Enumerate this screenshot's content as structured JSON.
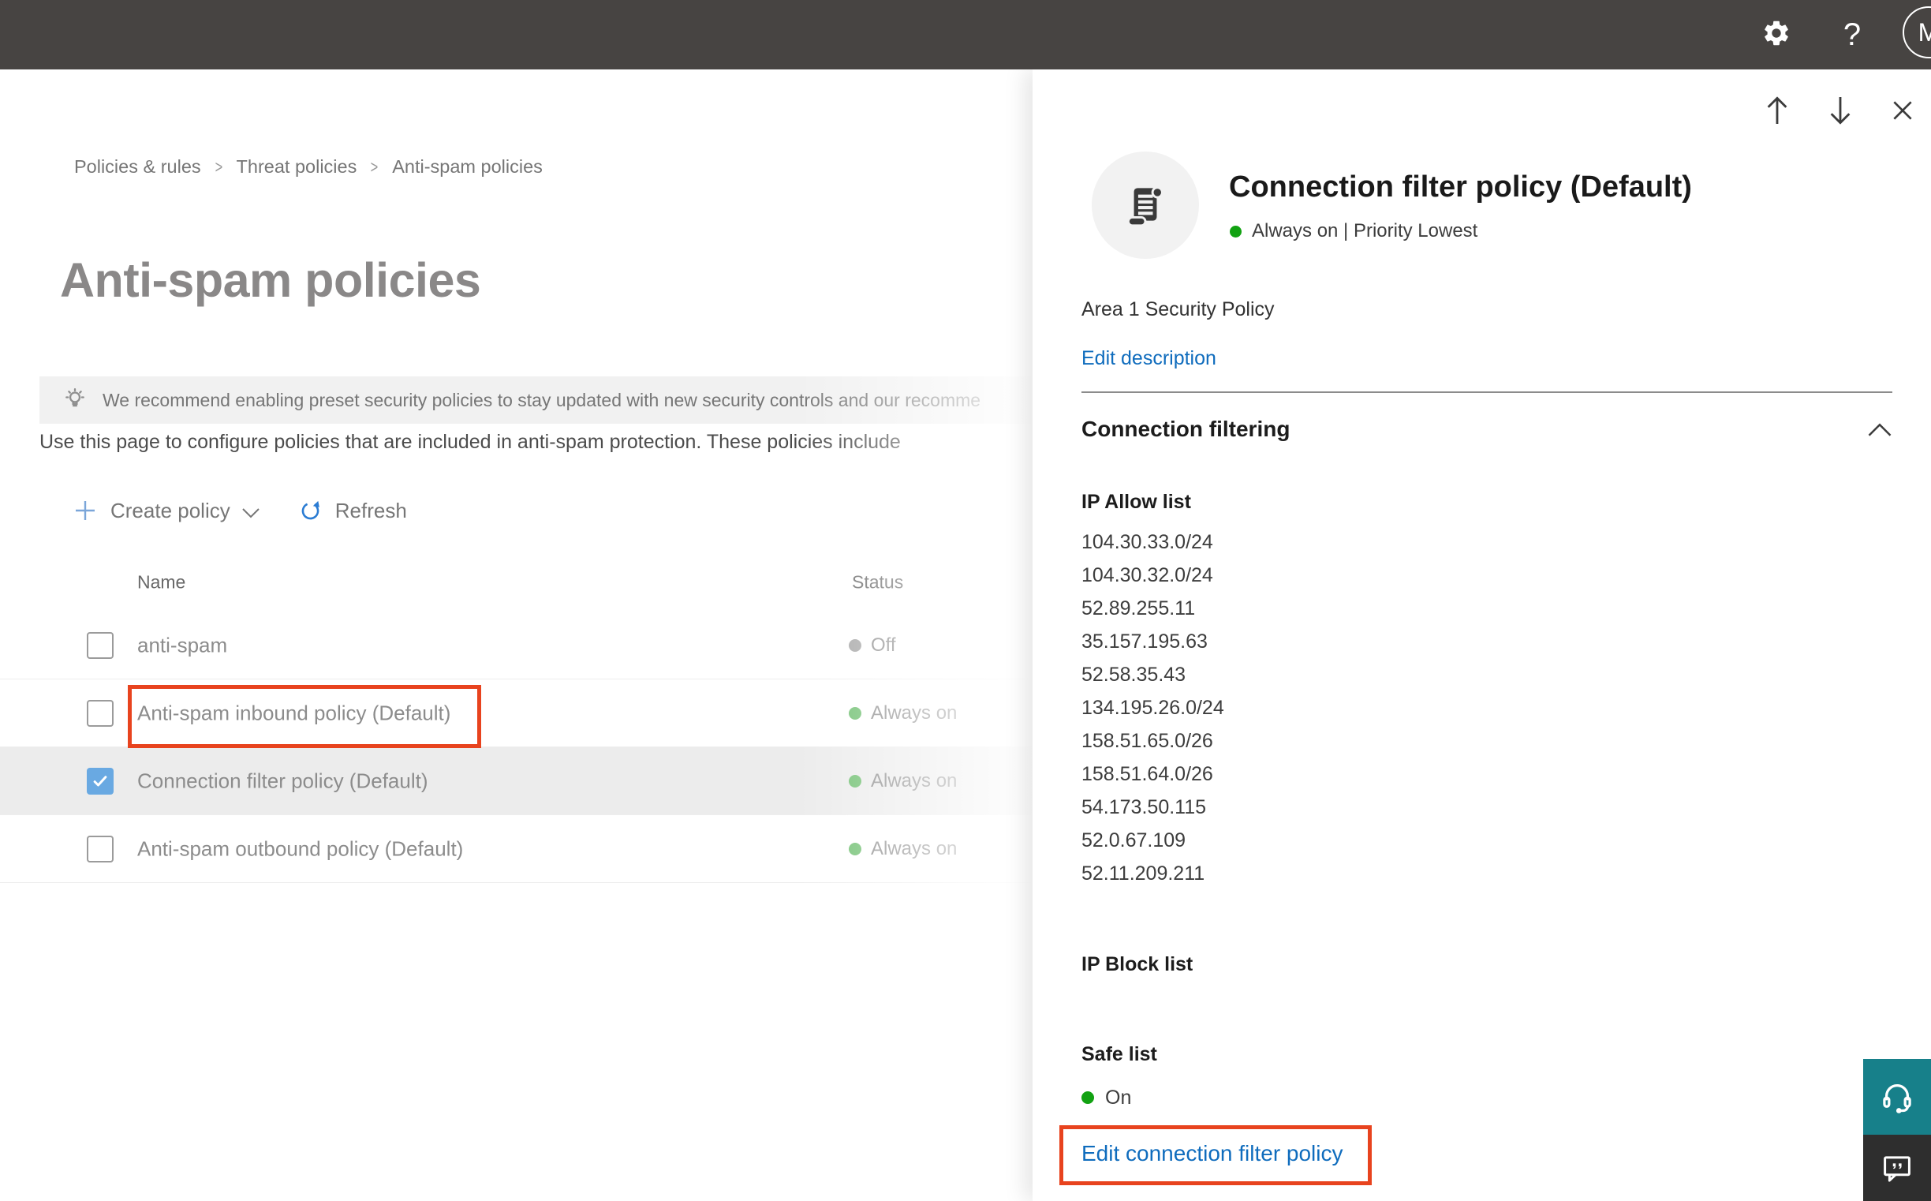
{
  "topbar": {
    "help_label": "?",
    "avatar_initial": "M",
    "bg_color": "#474442"
  },
  "breadcrumb": {
    "separator": ">",
    "items": [
      {
        "label": "Policies & rules"
      },
      {
        "label": "Threat policies"
      },
      {
        "label": "Anti-spam policies"
      }
    ]
  },
  "page": {
    "title": "Anti-spam policies",
    "banner_text": "We recommend enabling preset security policies to stay updated with new security controls and our recomme",
    "description": "Use this page to configure policies that are included in anti-spam protection. These policies include",
    "toolbar": {
      "create_label": "Create policy",
      "refresh_label": "Refresh"
    }
  },
  "table": {
    "columns": [
      "Name",
      "Status"
    ],
    "rows": [
      {
        "name": "anti-spam",
        "status": "Off",
        "dot_color": "#a6a6a6"
      },
      {
        "name": "Anti-spam inbound policy (Default)",
        "status": "Always on",
        "dot_color": "#6fbf70"
      },
      {
        "name": "Connection filter policy (Default)",
        "status": "Always on",
        "dot_color": "#6fbf70"
      },
      {
        "name": "Anti-spam outbound policy (Default)",
        "status": "Always on",
        "dot_color": "#6fbf70"
      }
    ]
  },
  "flyout": {
    "title": "Connection filter policy (Default)",
    "status_text": "Always on | Priority Lowest",
    "status_dot_color": "#12a212",
    "description": "Area 1 Security Policy",
    "edit_description_label": "Edit description",
    "section_title": "Connection filtering",
    "ip_allow": {
      "label": "IP Allow list",
      "items": [
        "104.30.33.0/24",
        "104.30.32.0/24",
        "52.89.255.11",
        "35.157.195.63",
        "52.58.35.43",
        "134.195.26.0/24",
        "158.51.65.0/26",
        "158.51.64.0/26",
        "54.173.50.115",
        "52.0.67.109",
        "52.11.209.211"
      ]
    },
    "ip_block_label": "IP Block list",
    "safe_list": {
      "label": "Safe list",
      "status": "On",
      "dot_color": "#12a212"
    },
    "edit_policy_label": "Edit connection filter policy"
  },
  "colors": {
    "accent_link": "#0f6cbd",
    "annotation_red": "#e8431e",
    "checkbox_blue": "#69a9e2",
    "support_teal": "#17808a",
    "feedback_dark": "#2e2e2e"
  }
}
